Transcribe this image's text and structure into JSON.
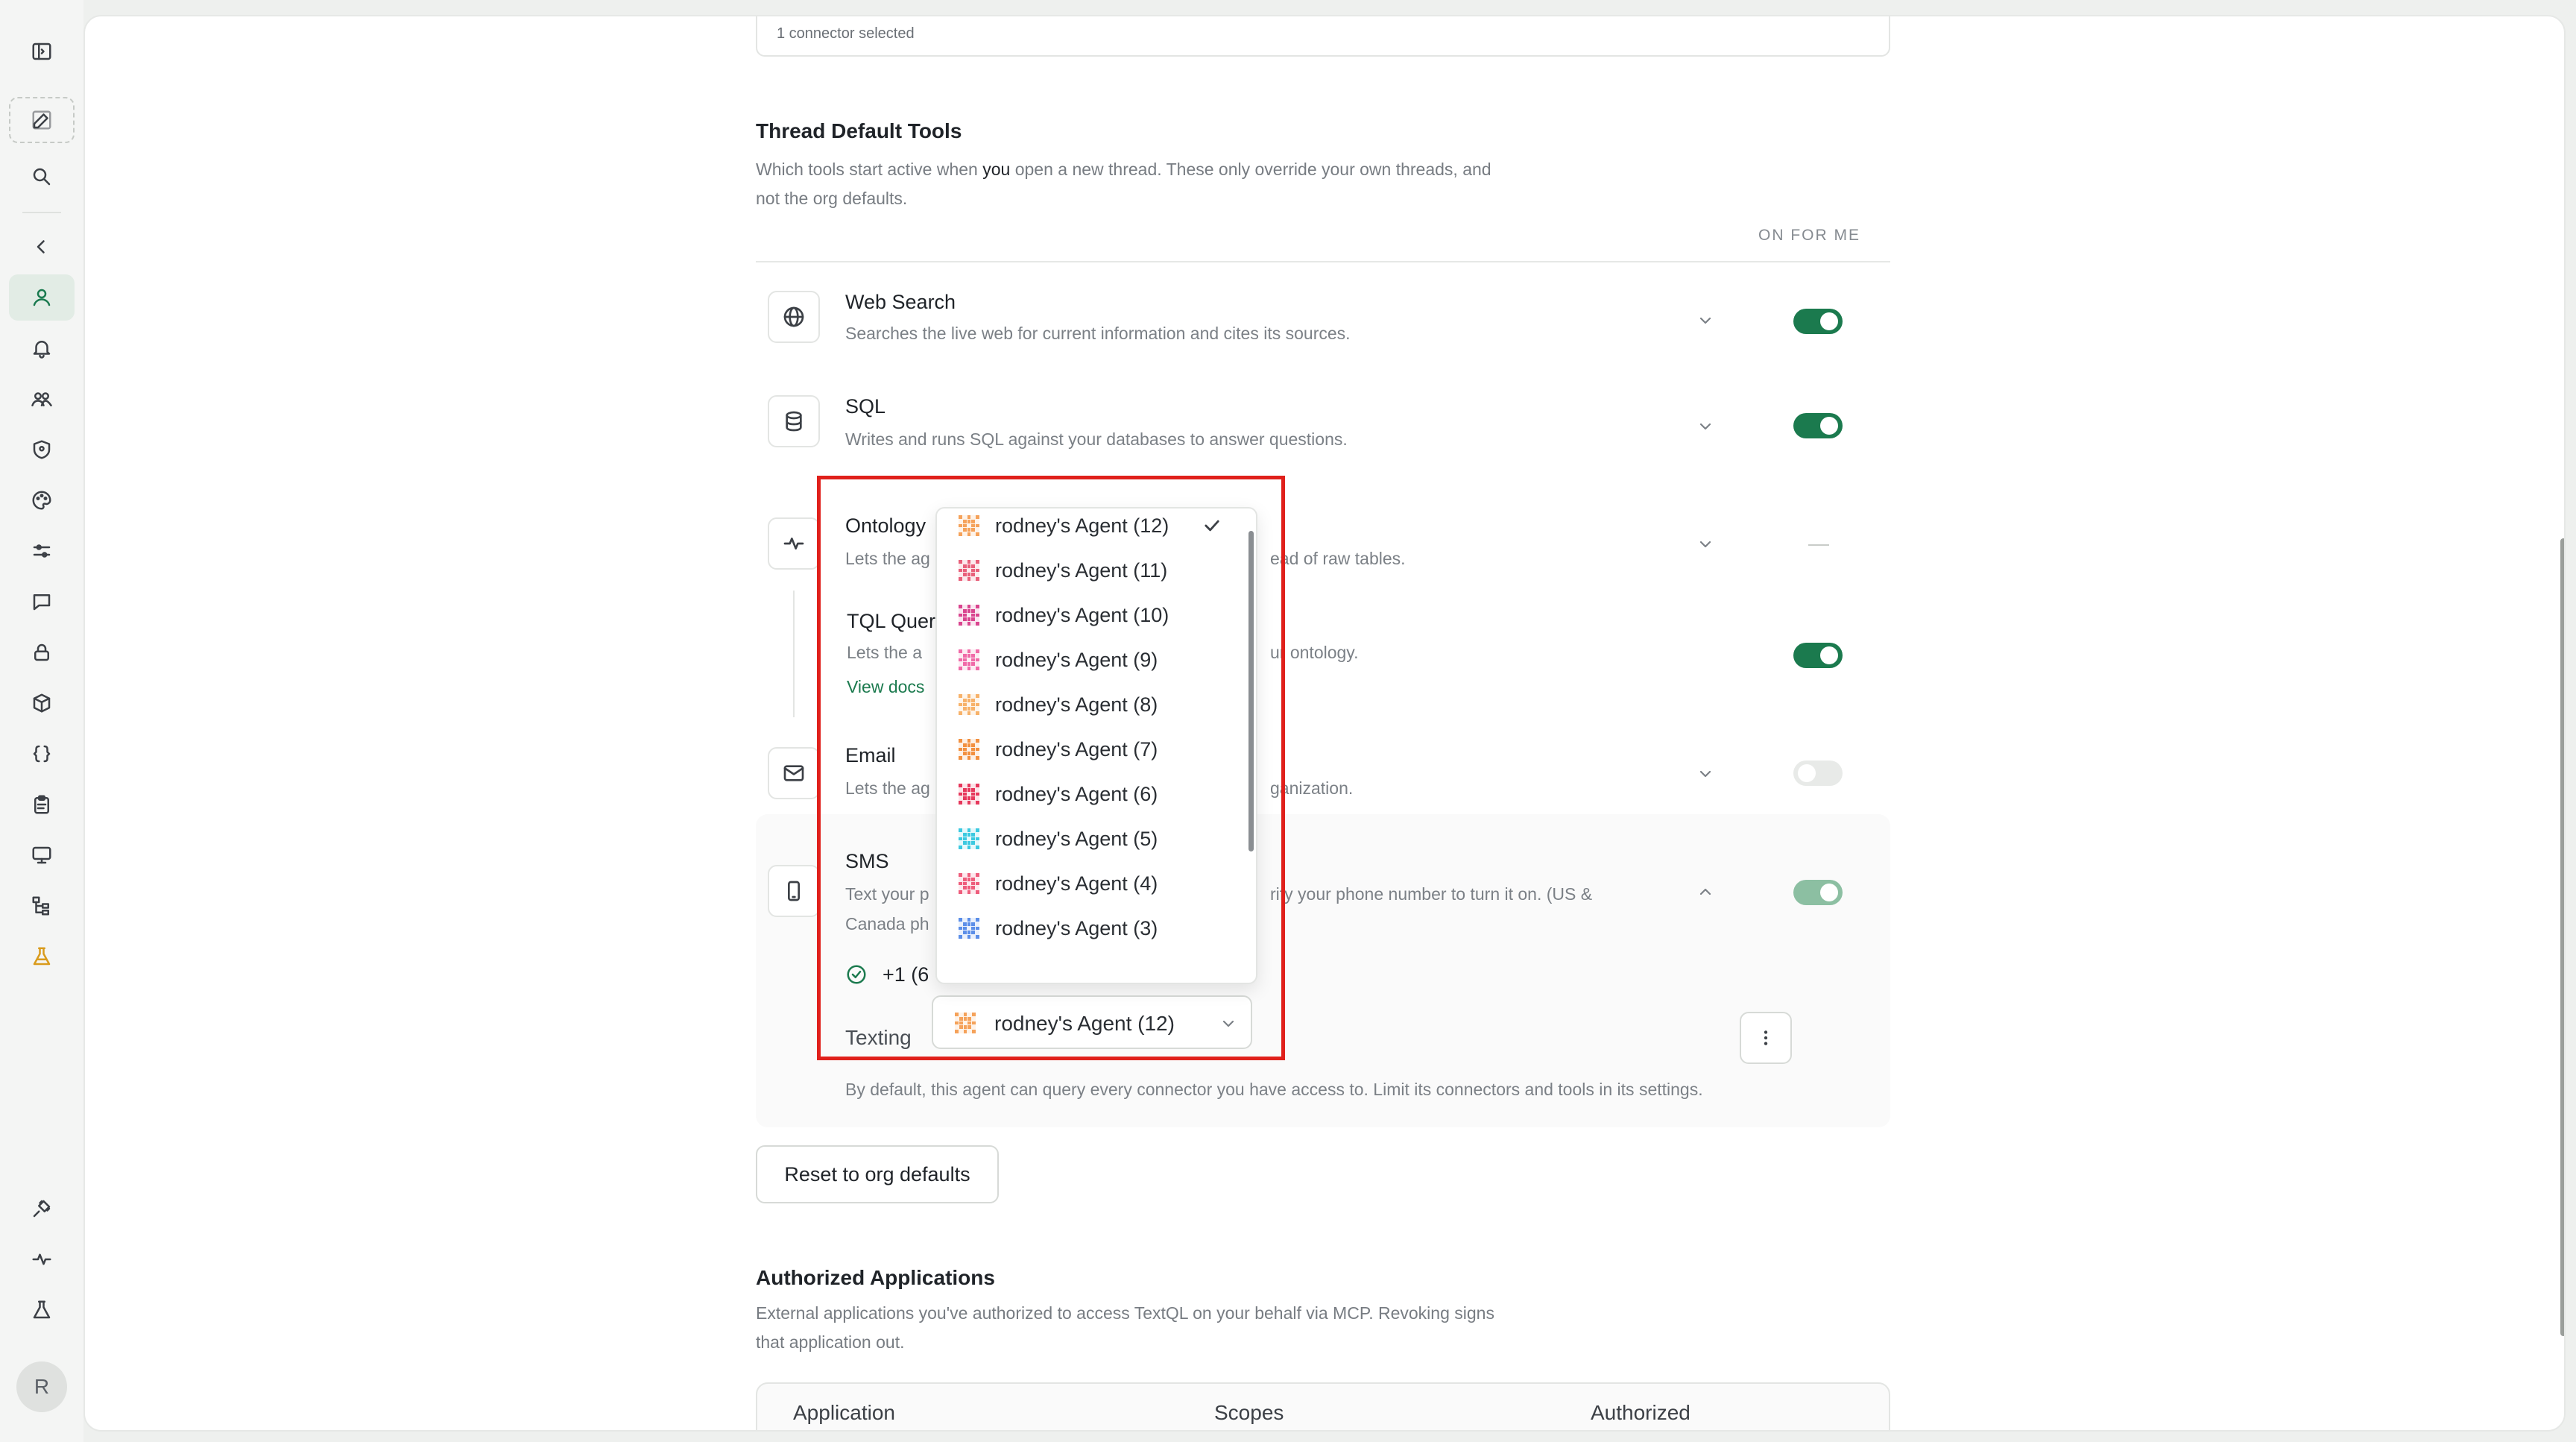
{
  "connectors": {
    "selected_text": "1 connector selected"
  },
  "thread_tools": {
    "title": "Thread Default Tools",
    "desc_line1_pre": "Which tools start active when ",
    "desc_line1_em": "you",
    "desc_line1_post": " open a new thread. These only override your own threads, and",
    "desc_line2": "not the org defaults.",
    "column_header": "ON FOR ME",
    "tools": {
      "web_search": {
        "name": "Web Search",
        "desc": "Searches the live web for current information and cites its sources.",
        "icon": "globe-icon",
        "enabled": true
      },
      "sql": {
        "name": "SQL",
        "desc": "Writes and runs SQL against your databases to answer questions.",
        "icon": "database-icon",
        "enabled": true
      },
      "ontology": {
        "name": "Ontology",
        "desc_start": "Lets the ag",
        "desc_end": "ead of raw tables.",
        "icon": "activity-icon"
      },
      "tql": {
        "name": "TQL Quer",
        "desc_start": "Lets the a",
        "desc_end": "ur ontology.",
        "link": "View docs",
        "enabled": true
      },
      "email": {
        "name": "Email",
        "desc_start": "Lets the ag",
        "desc_end": "ganization.",
        "icon": "mail-icon",
        "enabled": false
      },
      "sms": {
        "name": "SMS",
        "desc_start": "Text your p",
        "desc_end": "rify your phone number to turn it on. (US &",
        "desc_line2": "Canada ph",
        "icon": "phone-icon",
        "enabled": true,
        "phone": "+1 (6",
        "texting_label": "Texting",
        "note": "By default, this agent can query every connector you have access to. Limit its connectors and tools in its settings."
      }
    }
  },
  "agent_select": {
    "selected": "rodney's Agent (12)",
    "options": [
      {
        "label": "rodney's Agent (12)",
        "color": "#f5a25a",
        "checked": true
      },
      {
        "label": "rodney's Agent (11)",
        "color": "#e8607a"
      },
      {
        "label": "rodney's Agent (10)",
        "color": "#d9458f"
      },
      {
        "label": "rodney's Agent (9)",
        "color": "#f06aa8"
      },
      {
        "label": "rodney's Agent (8)",
        "color": "#f7b26a"
      },
      {
        "label": "rodney's Agent (7)",
        "color": "#f29040"
      },
      {
        "label": "rodney's Agent (6)",
        "color": "#e6385c"
      },
      {
        "label": "rodney's Agent (5)",
        "color": "#3cc9e0"
      },
      {
        "label": "rodney's Agent (4)",
        "color": "#ee5d7c"
      },
      {
        "label": "rodney's Agent (3)",
        "color": "#5b8ee8"
      }
    ]
  },
  "reset_button": "Reset to org defaults",
  "authorized_apps": {
    "title": "Authorized Applications",
    "desc_line1": "External applications you've authorized to access TextQL on your behalf via MCP. Revoking signs",
    "desc_line2": "that application out.",
    "columns": [
      "Application",
      "Scopes",
      "Authorized"
    ]
  },
  "user": {
    "initial": "R"
  }
}
